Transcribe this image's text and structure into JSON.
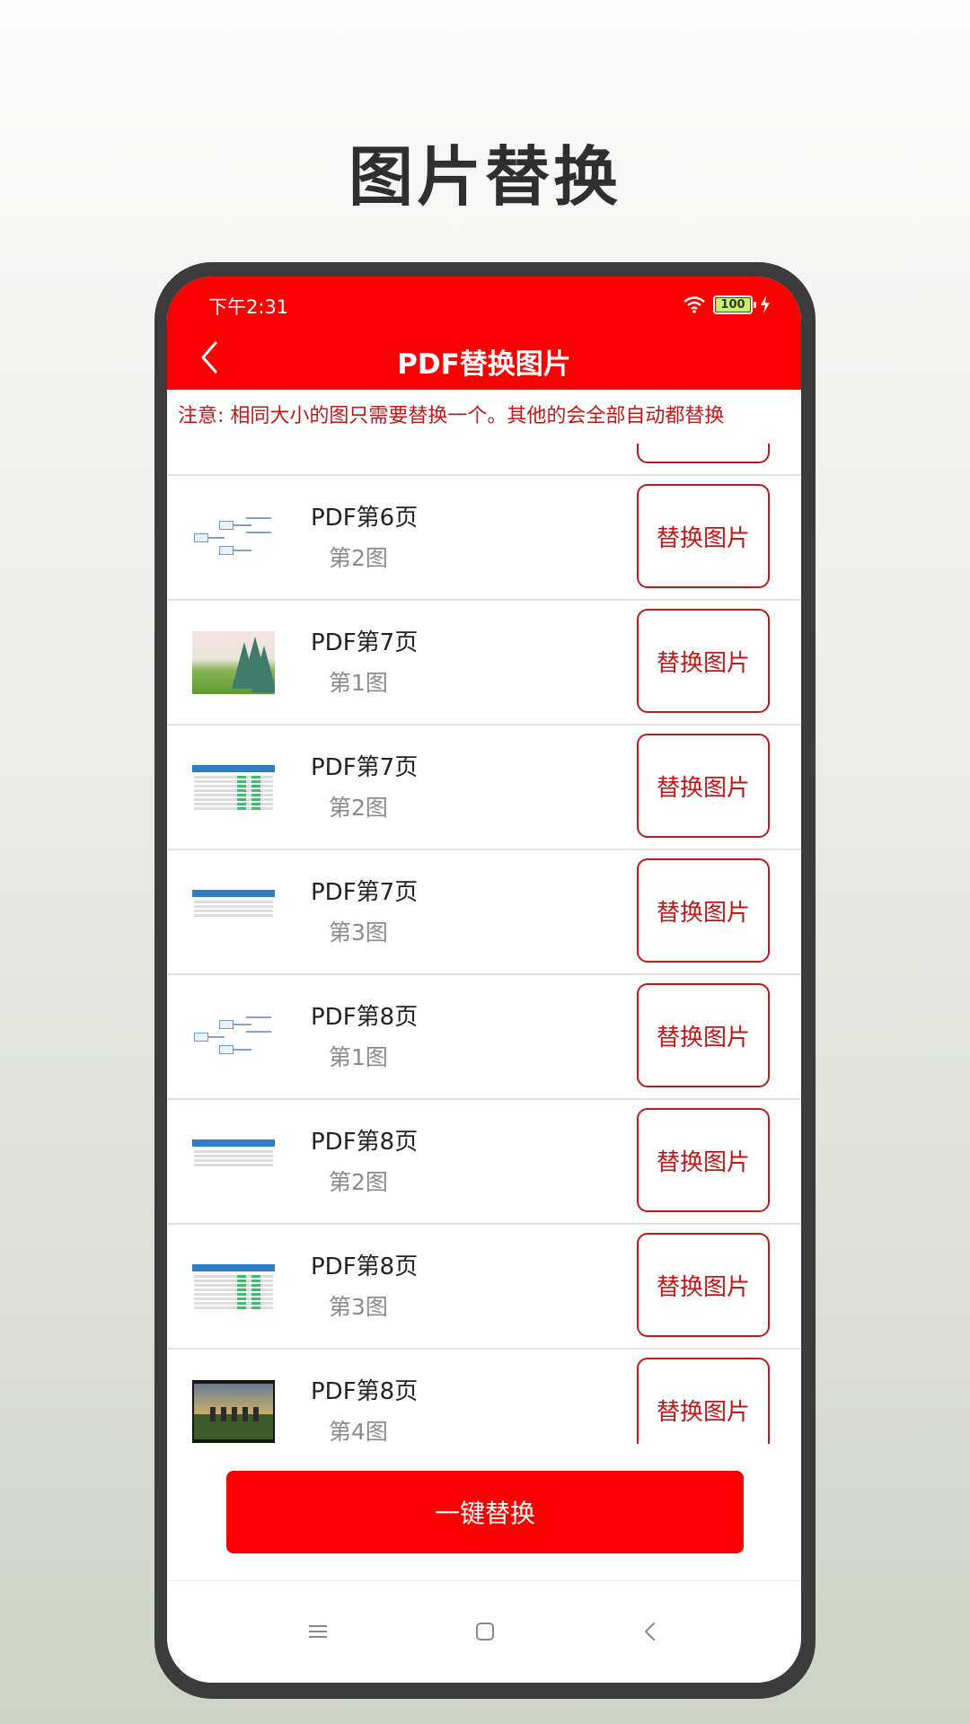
{
  "promo": {
    "title": "图片替换"
  },
  "status_bar": {
    "time": "下午2:31",
    "battery": "100"
  },
  "appbar": {
    "title": "PDF替换图片"
  },
  "notice": "注意: 相同大小的图只需要替换一个。其他的会全部自动都替换",
  "list": {
    "button_label": "替换图片",
    "items": [
      {
        "page": "",
        "image": "",
        "thumb": "none"
      },
      {
        "page": "PDF第6页",
        "image": "第2图",
        "thumb": "mindmap-diagram"
      },
      {
        "page": "PDF第7页",
        "image": "第1图",
        "thumb": "landscape-photo"
      },
      {
        "page": "PDF第7页",
        "image": "第2图",
        "thumb": "table-screenshot"
      },
      {
        "page": "PDF第7页",
        "image": "第3图",
        "thumb": "form-screenshot"
      },
      {
        "page": "PDF第8页",
        "image": "第1图",
        "thumb": "mindmap-diagram"
      },
      {
        "page": "PDF第8页",
        "image": "第2图",
        "thumb": "form-screenshot"
      },
      {
        "page": "PDF第8页",
        "image": "第3图",
        "thumb": "table-screenshot"
      },
      {
        "page": "PDF第8页",
        "image": "第4图",
        "thumb": "stonehenge-photo"
      }
    ]
  },
  "one_click_button": "一键替换",
  "nav": {
    "icons": [
      "menu-icon",
      "home-icon",
      "back-icon"
    ]
  },
  "colors": {
    "brand_red": "#fb0000",
    "accent_red": "#c01818"
  }
}
